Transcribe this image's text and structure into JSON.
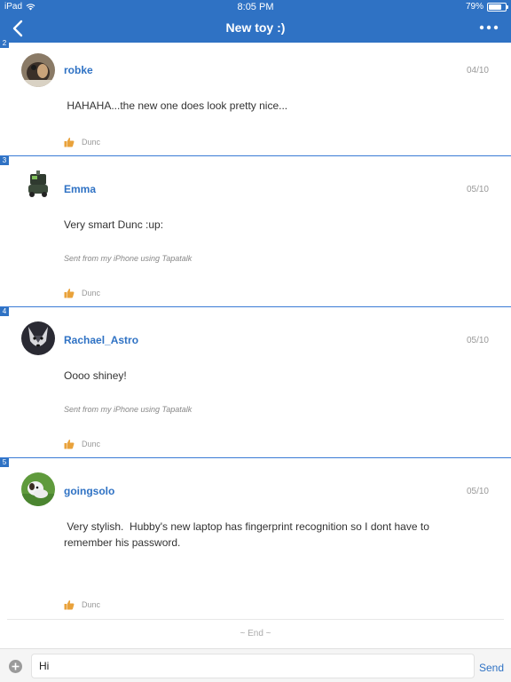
{
  "status_bar": {
    "device": "iPad",
    "time": "8:05 PM",
    "battery": "79%",
    "battery_level": 0.79
  },
  "nav": {
    "title": "New toy :)",
    "back_icon": "chevron-left-icon",
    "more_icon": "more-dots-icon"
  },
  "colors": {
    "brand": "#2f72c4",
    "like": "#e9a23b"
  },
  "posts": [
    {
      "number": "2",
      "username": "robke",
      "date": "04/10",
      "body": " HAHAHA...the new one does look pretty nice...",
      "signature": "",
      "liked_by": "Dunc"
    },
    {
      "number": "3",
      "username": "Emma",
      "date": "05/10",
      "body": "Very smart Dunc :up:",
      "signature": "Sent from my iPhone using Tapatalk",
      "liked_by": "Dunc"
    },
    {
      "number": "4",
      "username": "Rachael_Astro",
      "date": "05/10",
      "body": "Oooo shiney!",
      "signature": "Sent from my iPhone using Tapatalk",
      "liked_by": "Dunc"
    },
    {
      "number": "5",
      "username": "goingsolo",
      "date": "05/10",
      "body": " Very stylish.  Hubby's new laptop has fingerprint recognition so I dont have to remember his password.",
      "signature": "",
      "liked_by": "Dunc"
    }
  ],
  "end_text": "~ End ~",
  "composer": {
    "value": "Hi",
    "send_label": "Send"
  }
}
